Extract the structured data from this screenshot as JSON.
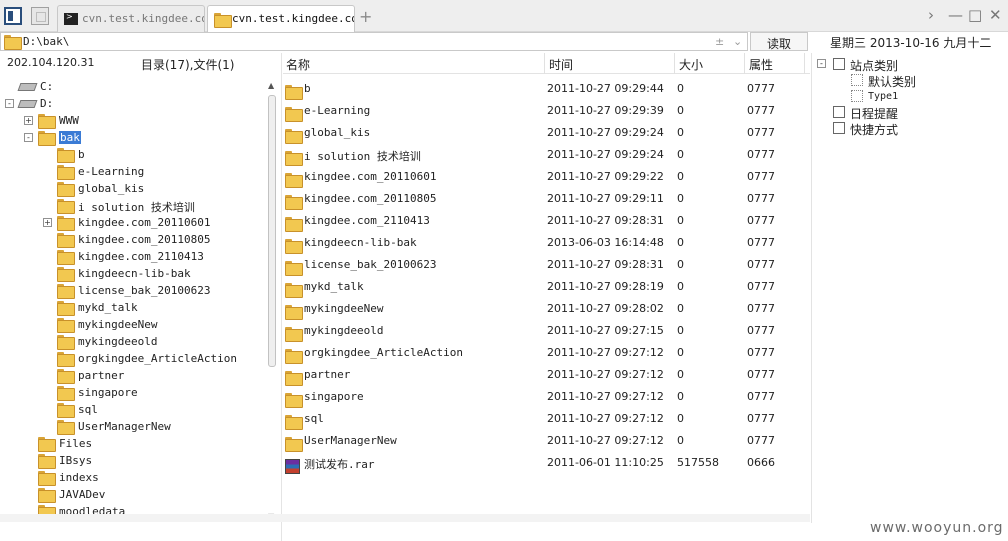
{
  "tabs": [
    {
      "label": "cvn.test.kingdee.com",
      "active": false,
      "icon": "terminal-icon"
    },
    {
      "label": "cvn.test.kingdee.com",
      "active": true,
      "icon": "folder-icon"
    }
  ],
  "address": {
    "path": "D:\\bak\\",
    "read_label": "读取"
  },
  "date_info": "星期三  2013-10-16  九月十二",
  "left_header": {
    "ip": "202.104.120.31",
    "count": "目录(17),文件(1)"
  },
  "tree": [
    {
      "label": "C:",
      "type": "drive",
      "toggle": ""
    },
    {
      "label": "D:",
      "type": "drive",
      "toggle": "-"
    },
    {
      "label": "WWW",
      "type": "folder",
      "toggle": "+"
    },
    {
      "label": "bak",
      "type": "folder",
      "toggle": "-",
      "selected": true
    },
    {
      "label": "b",
      "type": "folder",
      "toggle": ""
    },
    {
      "label": "e-Learning",
      "type": "folder",
      "toggle": ""
    },
    {
      "label": "global_kis",
      "type": "folder",
      "toggle": ""
    },
    {
      "label": "i solution 技术培训",
      "type": "folder",
      "toggle": ""
    },
    {
      "label": "kingdee.com_20110601",
      "type": "folder",
      "toggle": "+"
    },
    {
      "label": "kingdee.com_20110805",
      "type": "folder",
      "toggle": ""
    },
    {
      "label": "kingdee.com_2110413",
      "type": "folder",
      "toggle": ""
    },
    {
      "label": "kingdeecn-lib-bak",
      "type": "folder",
      "toggle": ""
    },
    {
      "label": "license_bak_20100623",
      "type": "folder",
      "toggle": ""
    },
    {
      "label": "mykd_talk",
      "type": "folder",
      "toggle": ""
    },
    {
      "label": "mykingdeeNew",
      "type": "folder",
      "toggle": ""
    },
    {
      "label": "mykingdeeold",
      "type": "folder",
      "toggle": ""
    },
    {
      "label": "orgkingdee_ArticleAction",
      "type": "folder",
      "toggle": ""
    },
    {
      "label": "partner",
      "type": "folder",
      "toggle": ""
    },
    {
      "label": "singapore",
      "type": "folder",
      "toggle": ""
    },
    {
      "label": "sql",
      "type": "folder",
      "toggle": ""
    },
    {
      "label": "UserManagerNew",
      "type": "folder",
      "toggle": ""
    },
    {
      "label": "Files",
      "type": "folder",
      "toggle": ""
    },
    {
      "label": "IBsys",
      "type": "folder",
      "toggle": ""
    },
    {
      "label": "indexs",
      "type": "folder",
      "toggle": ""
    },
    {
      "label": "JAVADev",
      "type": "folder",
      "toggle": ""
    },
    {
      "label": "moodledata",
      "type": "folder",
      "toggle": ""
    }
  ],
  "list_columns": {
    "name": "名称",
    "time": "时间",
    "size": "大小",
    "attr": "属性"
  },
  "files": [
    {
      "name": "b",
      "time": "2011-10-27 09:29:44",
      "size": "0",
      "attr": "0777",
      "type": "folder"
    },
    {
      "name": "e-Learning",
      "time": "2011-10-27 09:29:39",
      "size": "0",
      "attr": "0777",
      "type": "folder"
    },
    {
      "name": "global_kis",
      "time": "2011-10-27 09:29:24",
      "size": "0",
      "attr": "0777",
      "type": "folder"
    },
    {
      "name": "i solution 技术培训",
      "time": "2011-10-27 09:29:24",
      "size": "0",
      "attr": "0777",
      "type": "folder"
    },
    {
      "name": "kingdee.com_20110601",
      "time": "2011-10-27 09:29:22",
      "size": "0",
      "attr": "0777",
      "type": "folder"
    },
    {
      "name": "kingdee.com_20110805",
      "time": "2011-10-27 09:29:11",
      "size": "0",
      "attr": "0777",
      "type": "folder"
    },
    {
      "name": "kingdee.com_2110413",
      "time": "2011-10-27 09:28:31",
      "size": "0",
      "attr": "0777",
      "type": "folder"
    },
    {
      "name": "kingdeecn-lib-bak",
      "time": "2013-06-03 16:14:48",
      "size": "0",
      "attr": "0777",
      "type": "folder"
    },
    {
      "name": "license_bak_20100623",
      "time": "2011-10-27 09:28:31",
      "size": "0",
      "attr": "0777",
      "type": "folder"
    },
    {
      "name": "mykd_talk",
      "time": "2011-10-27 09:28:19",
      "size": "0",
      "attr": "0777",
      "type": "folder"
    },
    {
      "name": "mykingdeeNew",
      "time": "2011-10-27 09:28:02",
      "size": "0",
      "attr": "0777",
      "type": "folder"
    },
    {
      "name": "mykingdeeold",
      "time": "2011-10-27 09:27:15",
      "size": "0",
      "attr": "0777",
      "type": "folder"
    },
    {
      "name": "orgkingdee_ArticleAction",
      "time": "2011-10-27 09:27:12",
      "size": "0",
      "attr": "0777",
      "type": "folder"
    },
    {
      "name": "partner",
      "time": "2011-10-27 09:27:12",
      "size": "0",
      "attr": "0777",
      "type": "folder"
    },
    {
      "name": "singapore",
      "time": "2011-10-27 09:27:12",
      "size": "0",
      "attr": "0777",
      "type": "folder"
    },
    {
      "name": "sql",
      "time": "2011-10-27 09:27:12",
      "size": "0",
      "attr": "0777",
      "type": "folder"
    },
    {
      "name": "UserManagerNew",
      "time": "2011-10-27 09:27:12",
      "size": "0",
      "attr": "0777",
      "type": "folder"
    },
    {
      "name": "测试发布.rar",
      "time": "2011-06-01 11:10:25",
      "size": "517558",
      "attr": "0666",
      "type": "rar"
    }
  ],
  "right_tree": [
    {
      "label": "站点类别",
      "toggle": "-",
      "icon": "category-icon"
    },
    {
      "label": "默认类别",
      "toggle": "",
      "icon": "sub-category-icon"
    },
    {
      "label": "Type1",
      "toggle": "",
      "icon": "sub-category-icon"
    },
    {
      "label": "日程提醒",
      "toggle": "",
      "icon": "reminder-icon"
    },
    {
      "label": "快捷方式",
      "toggle": "",
      "icon": "shortcut-icon"
    }
  ],
  "watermark": "www.wooyun.org"
}
